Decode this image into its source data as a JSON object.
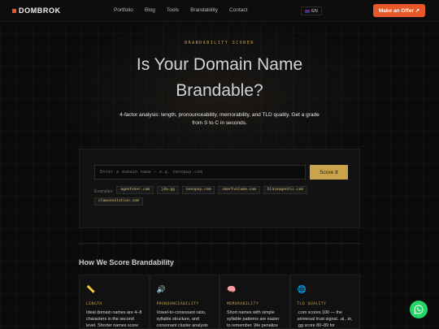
{
  "brand": {
    "name": "DOMBROK",
    "accent": "#e8572a",
    "gold": "#c9a44a"
  },
  "nav": {
    "items": [
      "Portfolio",
      "Blog",
      "Tools",
      "Brandability",
      "Contact"
    ]
  },
  "lang": {
    "label": "EN",
    "icon": "uk-flag-icon"
  },
  "header": {
    "cta_label": "Make an Offer ↗"
  },
  "hero": {
    "kicker": "BRANDABILITY SCORER",
    "title": "Is Your Domain Name Brandable?",
    "subtitle": "4-factor analysis: length, pronounceability, memorability, and TLD quality. Get a grade from S to C in seconds."
  },
  "scorer": {
    "input_placeholder": "Enter a domain name — e.g. nexopay.com",
    "input_value": "",
    "button_label": "Score It",
    "examples_label": "Examples:",
    "examples": [
      "agentsker.com",
      "j4a.gg",
      "nexopay.com",
      "smartvolume.com",
      "blazeagentic.com",
      "clawsevolution.com"
    ]
  },
  "section": {
    "title": "How We Score Brandability"
  },
  "cards": [
    {
      "icon": "ruler-icon",
      "glyph": "📏",
      "label": "LENGTH",
      "text": "Ideal domain names are 4–8 characters in the second level. Shorter names score"
    },
    {
      "icon": "speaker-icon",
      "glyph": "🔊",
      "label": "PRONOUNCEABILITY",
      "text": "Vowel-to-consonant ratio, syllable structure, and consonant cluster analysis"
    },
    {
      "icon": "brain-icon",
      "glyph": "🧠",
      "label": "MEMORABILITY",
      "text": "Short names with simple syllable patterns are easier to remember. We penalize"
    },
    {
      "icon": "globe-icon",
      "glyph": "🌐",
      "label": "TLD QUALITY",
      "text": ".com scores 100 — the universal trust signal. .ai, .io, .gg score 80–89 for"
    }
  ],
  "whatsapp": {
    "icon": "whatsapp-icon",
    "color": "#25d366"
  }
}
